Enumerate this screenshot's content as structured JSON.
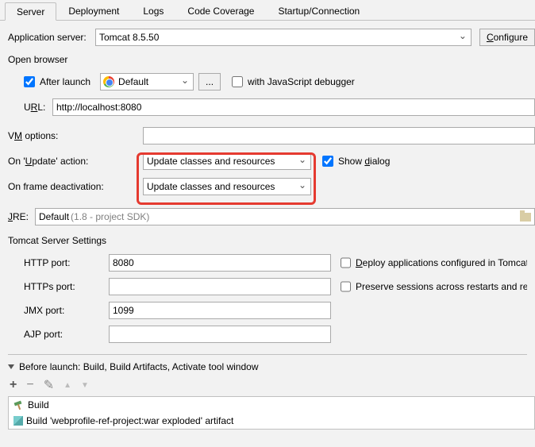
{
  "tabs": {
    "server": "Server",
    "deployment": "Deployment",
    "logs": "Logs",
    "coverage": "Code Coverage",
    "startup": "Startup/Connection"
  },
  "appserver": {
    "label": "Application server:",
    "value": "Tomcat 8.5.50",
    "configure": "Configure"
  },
  "openbrowser": {
    "title": "Open browser",
    "after_launch": "After launch",
    "browser": "Default",
    "dots": "...",
    "js_debugger": "with JavaScript debugger",
    "url_label_pre": "U",
    "url_label_u": "R",
    "url_label_post": "L:",
    "url_value": "http://localhost:8080"
  },
  "vm": {
    "label_pre": "V",
    "label_u": "M",
    "label_post": " options:"
  },
  "update": {
    "label_pre": "On '",
    "label_u": "U",
    "label_post": "pdate' action:",
    "value": "Update classes and resources",
    "show_pre": "Show ",
    "show_u": "d",
    "show_post": "ialog"
  },
  "frame": {
    "label": "On frame deactivation:",
    "value": "Update classes and resources"
  },
  "jre": {
    "label_u": "J",
    "label_post": "RE:",
    "value": "Default",
    "hint": "(1.8 - project SDK)"
  },
  "tomcat_section": "Tomcat Server Settings",
  "ports": {
    "http": "HTTP port:",
    "http_val": "8080",
    "https": "HTTPs port:",
    "https_val": "",
    "jmx": "JMX port:",
    "jmx_val": "1099",
    "ajp": "AJP port:",
    "ajp_val": ""
  },
  "rightchecks": {
    "deploy_u": "D",
    "deploy_post": "eploy applications configured in Tomcat ins",
    "preserve": "Preserve sessions across restarts and redeplo"
  },
  "before": {
    "title": "Before launch: Build, Build Artifacts, Activate tool window",
    "item1": "Build",
    "item2": "Build 'webprofile-ref-project:war exploded' artifact"
  }
}
